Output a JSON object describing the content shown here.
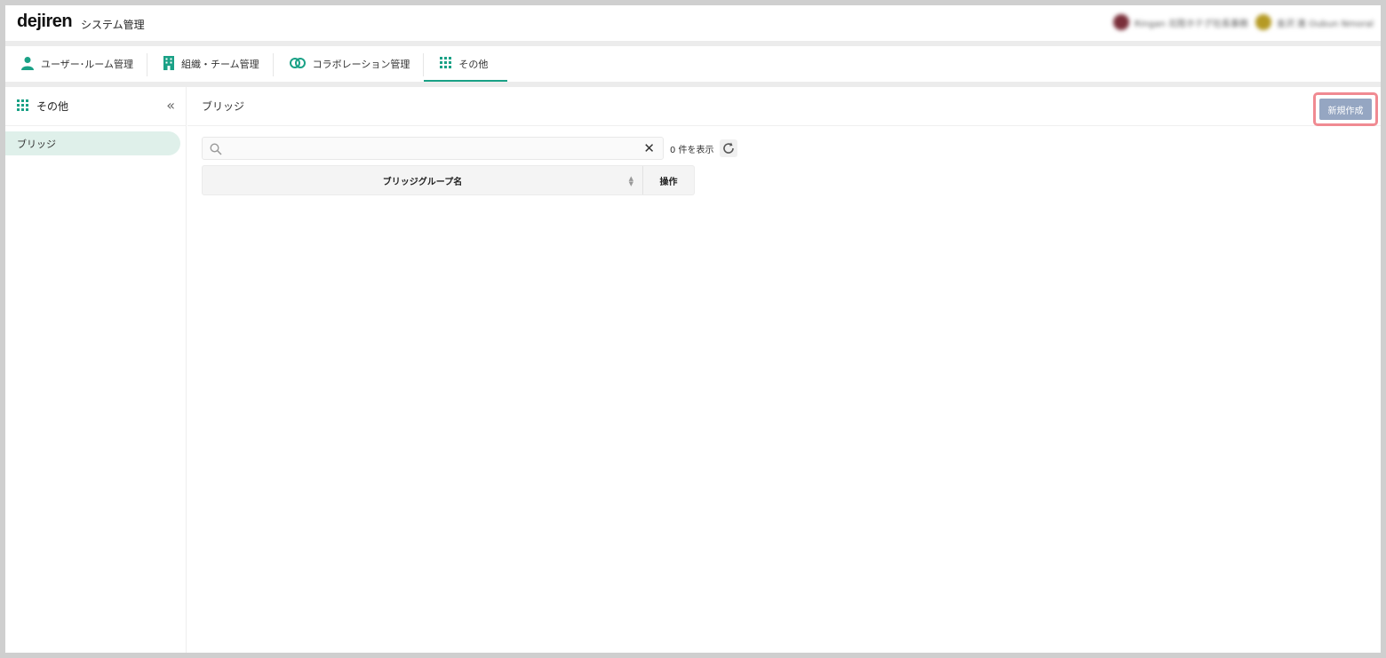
{
  "header": {
    "logo": "dejiren",
    "app_title": "システム管理",
    "users": [
      {
        "name": "Ringan 北陸ホテグ社長事務",
        "avatar_color": "#7a2f3a"
      },
      {
        "name": "金沢 進 Oubun Nmoral",
        "avatar_color": "#b59a24"
      }
    ]
  },
  "nav": {
    "tabs": [
      {
        "label": "ユーザー･ルーム管理",
        "icon": "person-icon",
        "active": false
      },
      {
        "label": "組織・チーム管理",
        "icon": "building-icon",
        "active": false
      },
      {
        "label": "コラボレーション管理",
        "icon": "link-icon",
        "active": false
      },
      {
        "label": "その他",
        "icon": "grid-icon",
        "active": true
      }
    ]
  },
  "sidebar": {
    "title": "その他",
    "collapse_icon": "double-chevron-left-icon",
    "items": [
      {
        "label": "ブリッジ",
        "selected": true
      }
    ]
  },
  "main": {
    "breadcrumb": "ブリッジ",
    "create_button": "新規作成",
    "search": {
      "value": "",
      "placeholder": ""
    },
    "count_text": "0 件を表示",
    "table": {
      "columns": [
        "ブリッジグループ名",
        "操作"
      ]
    }
  },
  "colors": {
    "accent": "#1aa186",
    "create_button": "#95a6c2",
    "highlight": "#f08a92",
    "selected_item": "#dff0ea"
  }
}
